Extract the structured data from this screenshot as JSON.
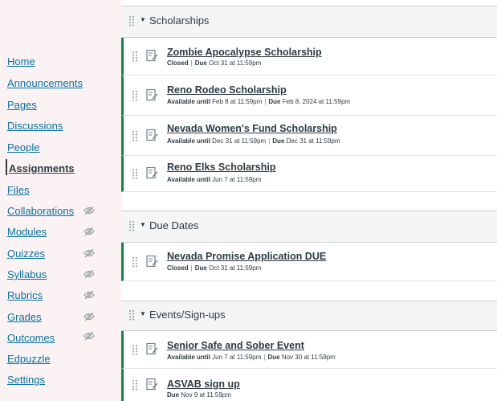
{
  "nav": {
    "items": [
      {
        "label": "Home",
        "hidden": false,
        "active": false
      },
      {
        "label": "Announcements",
        "hidden": false,
        "active": false
      },
      {
        "label": "Pages",
        "hidden": false,
        "active": false
      },
      {
        "label": "Discussions",
        "hidden": false,
        "active": false
      },
      {
        "label": "People",
        "hidden": false,
        "active": false
      },
      {
        "label": "Assignments",
        "hidden": false,
        "active": true
      },
      {
        "label": "Files",
        "hidden": false,
        "active": false
      },
      {
        "label": "Collaborations",
        "hidden": true,
        "active": false
      },
      {
        "label": "Modules",
        "hidden": true,
        "active": false
      },
      {
        "label": "Quizzes",
        "hidden": true,
        "active": false
      },
      {
        "label": "Syllabus",
        "hidden": true,
        "active": false
      },
      {
        "label": "Rubrics",
        "hidden": true,
        "active": false
      },
      {
        "label": "Grades",
        "hidden": true,
        "active": false
      },
      {
        "label": "Outcomes",
        "hidden": true,
        "active": false
      },
      {
        "label": "Edpuzzle",
        "hidden": false,
        "active": false
      },
      {
        "label": "Settings",
        "hidden": false,
        "active": false
      }
    ],
    "hidden_icon": "eye-slash-icon"
  },
  "modules": [
    {
      "title": "Scholarships",
      "items": [
        {
          "title": "Zombie Apocalypse Scholarship",
          "meta": [
            {
              "label": "Closed",
              "value": ""
            },
            {
              "label": "Due",
              "value": "Oct 31 at 11:59pm"
            }
          ]
        },
        {
          "title": "Reno Rodeo Scholarship",
          "meta": [
            {
              "label": "Available until",
              "value": "Feb 8 at 11:59pm"
            },
            {
              "label": "Due",
              "value": "Feb 8, 2024 at 11:59pm"
            }
          ]
        },
        {
          "title": "Nevada Women's Fund Scholarship",
          "meta": [
            {
              "label": "Available until",
              "value": "Dec 31 at 11:59pm"
            },
            {
              "label": "Due",
              "value": "Dec 31 at 11:59pm"
            }
          ]
        },
        {
          "title": "Reno Elks Scholarship",
          "meta": [
            {
              "label": "Available until",
              "value": "Jun 7 at 11:59pm"
            }
          ]
        }
      ]
    },
    {
      "title": "Due Dates",
      "items": [
        {
          "title": "Nevada Promise Application DUE",
          "meta": [
            {
              "label": "Closed",
              "value": ""
            },
            {
              "label": "Due",
              "value": "Oct 31 at 11:59pm"
            }
          ]
        }
      ]
    },
    {
      "title": "Events/Sign-ups",
      "items": [
        {
          "title": "Senior Safe and Sober Event",
          "meta": [
            {
              "label": "Available until",
              "value": "Jun 7 at 11:59pm"
            },
            {
              "label": "Due",
              "value": "Nov 30 at 11:59pm"
            }
          ]
        },
        {
          "title": "ASVAB sign up",
          "meta": [
            {
              "label": "Due",
              "value": "Nov 9 at 11:59pm"
            }
          ]
        }
      ]
    }
  ],
  "icons": {
    "drag": "drag-handle-icon",
    "expand": "caret-down-icon",
    "assignment": "assignment-icon"
  },
  "colors": {
    "link": "#0770a3",
    "published": "#0b874b",
    "header_bg": "#f5f5f5",
    "text": "#2d3b45"
  }
}
